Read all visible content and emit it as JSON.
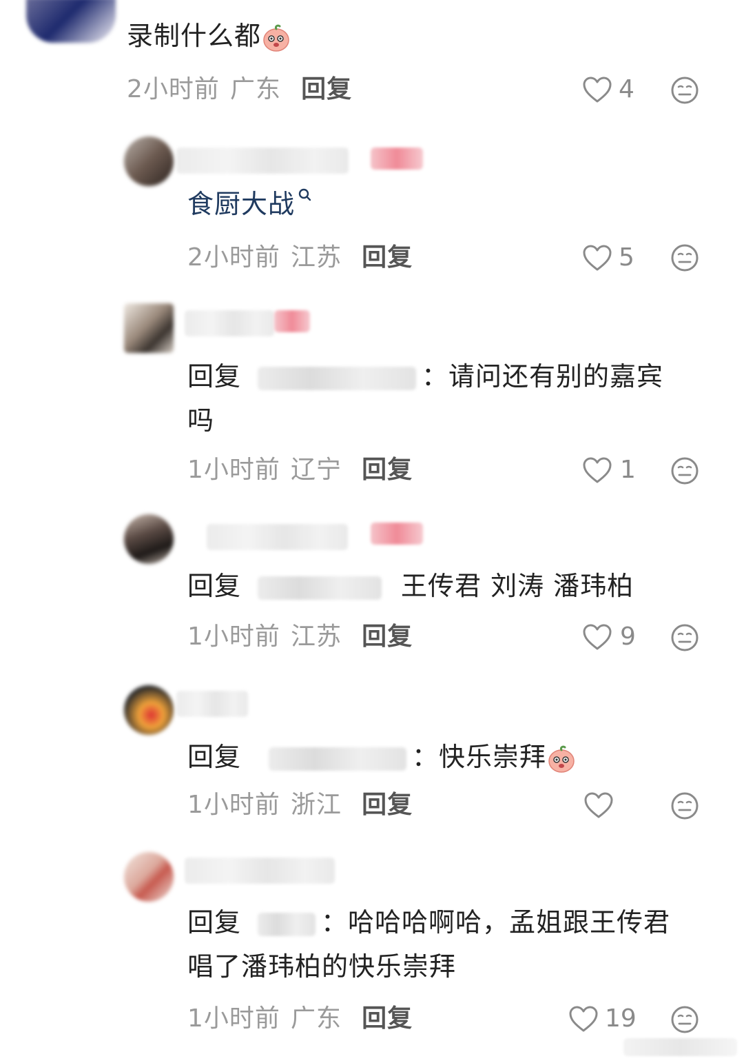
{
  "top_comment": {
    "text": "录制什么都",
    "time": "2小时前",
    "location": "广东",
    "reply_label": "回复",
    "likes": "4"
  },
  "replies": [
    {
      "text_link": "食厨大战",
      "time": "2小时前",
      "location": "江苏",
      "reply_label": "回复",
      "likes": "5"
    },
    {
      "prefix": "回复",
      "separator": "：",
      "text_line1": "请问还有别的嘉宾",
      "text_line2": "吗",
      "time": "1小时前",
      "location": "辽宁",
      "reply_label": "回复",
      "likes": "1"
    },
    {
      "prefix": "回复",
      "text": "王传君 刘涛 潘玮柏",
      "time": "1小时前",
      "location": "江苏",
      "reply_label": "回复",
      "likes": "9"
    },
    {
      "prefix": "回复",
      "separator": "：",
      "text": "快乐崇拜",
      "time": "1小时前",
      "location": "浙江",
      "reply_label": "回复",
      "likes": ""
    },
    {
      "prefix": "回复",
      "separator": "：",
      "text_line1": "哈哈哈啊哈，孟姐跟王传君",
      "text_line2": "唱了潘玮柏的快乐崇拜",
      "time": "1小时前",
      "location": "广东",
      "reply_label": "回复",
      "likes": "19"
    }
  ],
  "icons": {
    "like": "heart-outline-icon",
    "dislike": "neutral-face-icon",
    "search": "search-icon",
    "emoji": "peach-face-emoji"
  },
  "colors": {
    "text": "#222222",
    "meta": "#9a9a9a",
    "link": "#1f3a5f",
    "icon": "#8a8a8a"
  }
}
